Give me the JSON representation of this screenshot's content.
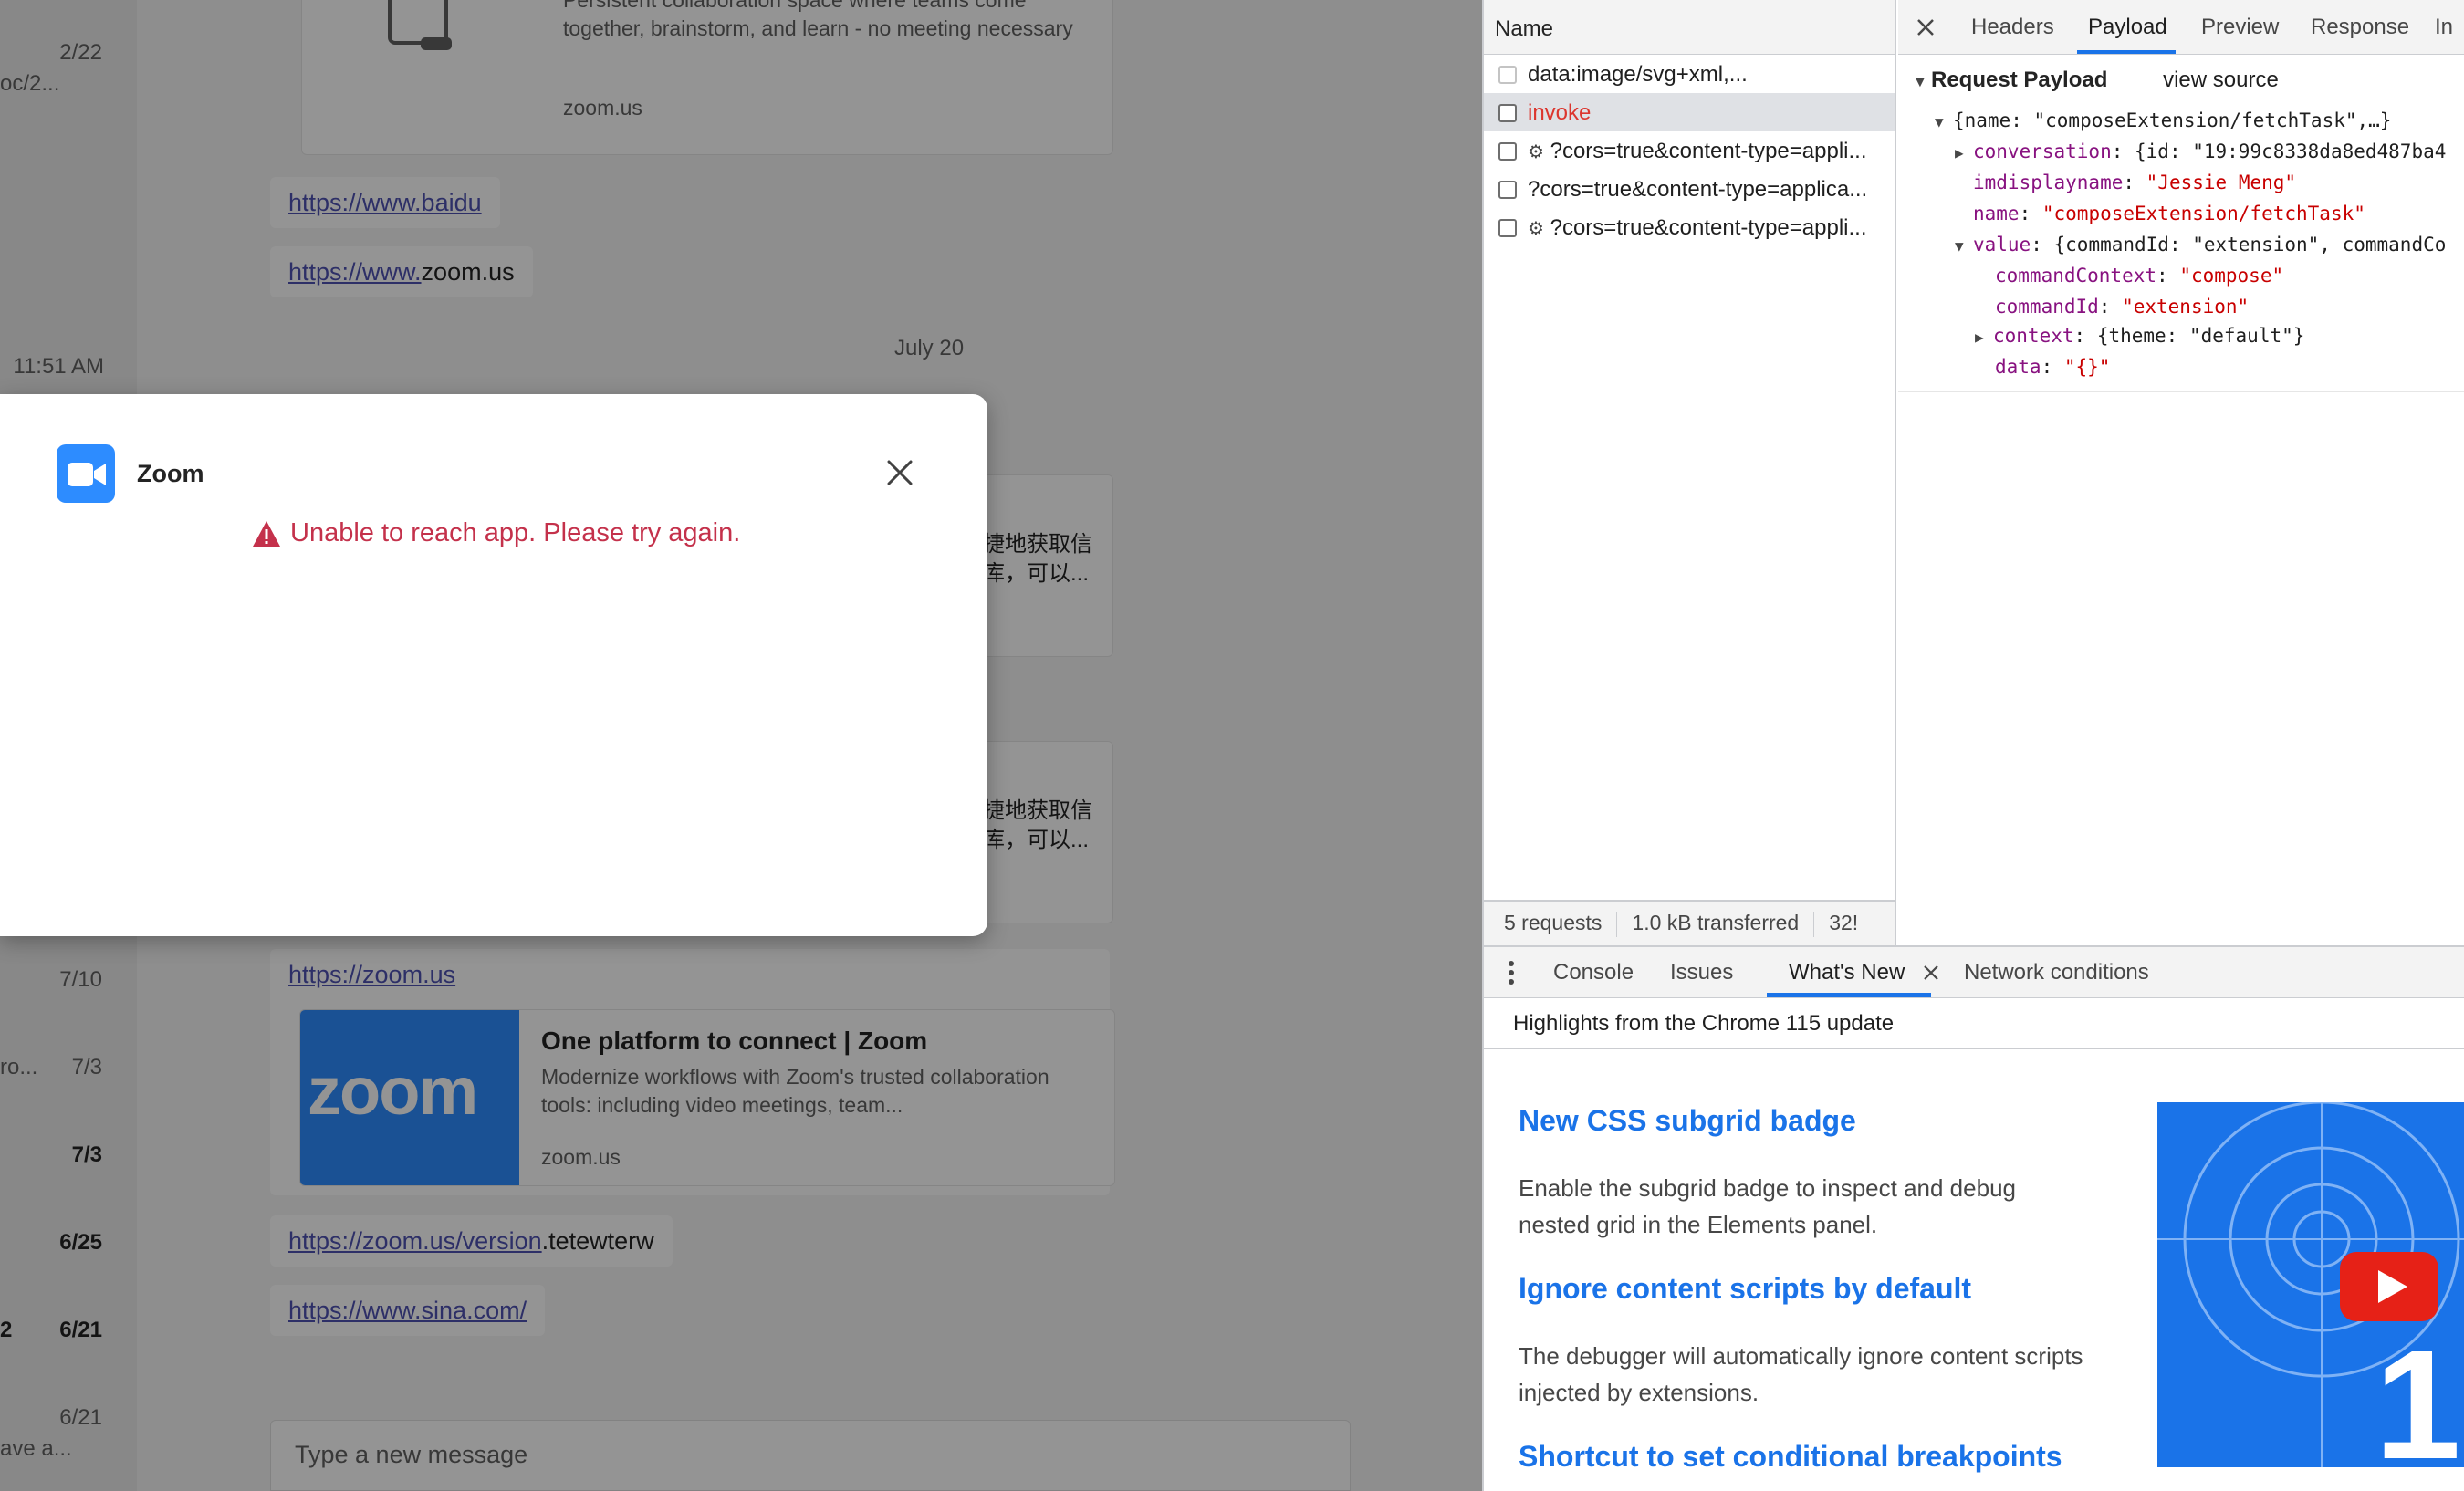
{
  "chat_list": {
    "dates": [
      "2/22",
      "11:51 AM",
      "7/10",
      "7/3",
      "7/3",
      "6/25",
      "6/21",
      "6/21"
    ],
    "snippets": [
      "oc/2...",
      "ro...",
      "2",
      "ave a..."
    ]
  },
  "conversation": {
    "card_top": {
      "desc": "Persistent collaboration space where teams come together, brainstorm, and learn - no meeting necessary",
      "site": "zoom.us"
    },
    "link_baidu": "https://www.baidu",
    "link_zoom_prefix": "https://www.",
    "link_zoom_suffix": "zoom.us",
    "day_separator": "July 20",
    "cjk_1a": "捷地获取信",
    "cjk_1b": "库，可以...",
    "cjk_2a": "捷地获取信",
    "cjk_2b": "库，可以...",
    "link_zoom_us": "https://zoom.us",
    "card_zoom": {
      "logo_text": "zoom",
      "title": "One platform to connect | Zoom",
      "desc": "Modernize workflows with Zoom's trusted collaboration tools: including video meetings, team...",
      "site": "zoom.us"
    },
    "link_version": "https://zoom.us/version",
    "link_version_suffix": ".tetewterw",
    "link_sina": "https://www.sina.com/",
    "composer_placeholder": "Type a new message"
  },
  "dialog": {
    "title": "Zoom",
    "error": "Unable to reach app. Please try again."
  },
  "devtools": {
    "network": {
      "column_name": "Name",
      "rows": [
        {
          "label": "data:image/svg+xml,..."
        },
        {
          "label": "invoke"
        },
        {
          "label": "?cors=true&content-type=appli..."
        },
        {
          "label": "?cors=true&content-type=applica..."
        },
        {
          "label": "?cors=true&content-type=appli..."
        }
      ],
      "footer": {
        "requests": "5 requests",
        "transferred": "1.0 kB transferred",
        "resources": "32!"
      }
    },
    "detail_tabs": [
      "Headers",
      "Payload",
      "Preview",
      "Response",
      "In"
    ],
    "payload": {
      "section_title": "Request Payload",
      "view_source": "view source",
      "root_summary": "{name: \"composeExtension/fetchTask\",…}",
      "conversation_key": "conversation",
      "conversation_summary": "{id: \"19:99c8338da8ed487ba4",
      "imdisplayname_key": "imdisplayname",
      "imdisplayname_val": "\"Jessie Meng\"",
      "name_key": "name",
      "name_val": "\"composeExtension/fetchTask\"",
      "value_key": "value",
      "value_summary": "{commandId: \"extension\", commandCo",
      "commandContext_key": "commandContext",
      "commandContext_val": "\"compose\"",
      "commandId_key": "commandId",
      "commandId_val": "\"extension\"",
      "context_key": "context",
      "context_summary": "{theme: \"default\"}",
      "data_key": "data",
      "data_val": "\"{}\""
    },
    "drawer_tabs": [
      "Console",
      "Issues",
      "What's New",
      "Network conditions"
    ],
    "highlights": "Highlights from the Chrome 115 update",
    "whats_new": [
      {
        "title": "New CSS subgrid badge",
        "body": "Enable the subgrid badge to inspect and debug nested grid in the Elements panel."
      },
      {
        "title": "Ignore content scripts by default",
        "body": "The debugger will automatically ignore content scripts injected by extensions."
      },
      {
        "title": "Shortcut to set conditional breakpoints",
        "body": ""
      }
    ]
  },
  "colors": {
    "teams_link": "#4f52b2",
    "error_red": "#c4314b",
    "zoom_blue": "#2d8cff",
    "devtools_blue": "#1a73e8",
    "network_error": "#dc362e"
  }
}
